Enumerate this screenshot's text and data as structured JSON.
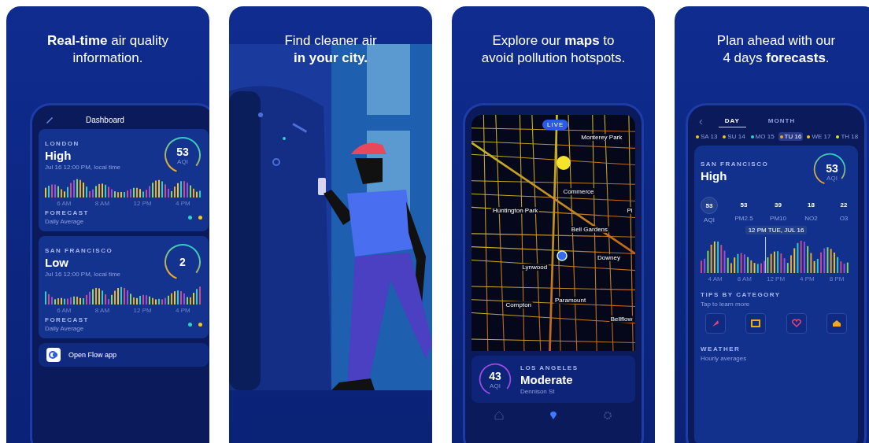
{
  "panels": [
    {
      "kind": "dashboard",
      "caption": [
        "**Real-time** air quality",
        "information."
      ],
      "screen_title": "Dashboard",
      "cities": [
        {
          "city": "LONDON",
          "level": "High",
          "time": "Jul 16 12:00 PM, local time",
          "aqi": "53",
          "aqi_label": "AQI",
          "ticks": [
            "6 AM",
            "8 AM",
            "12 PM",
            "4 PM"
          ],
          "forecast": "FORECAST",
          "forecast_sub": "Daily Average",
          "dots": [
            {
              "color": "#2ad1c9"
            },
            {
              "color": "#f5c518"
            }
          ]
        },
        {
          "city": "SAN FRANCISCO",
          "level": "Low",
          "time": "Jul 16 12:00 PM, local time",
          "aqi": "2",
          "ticks": [
            "6 AM",
            "8 AM",
            "12 PM",
            "4 PM"
          ],
          "forecast": "FORECAST",
          "forecast_sub": "Daily Average",
          "dots": [
            {
              "color": "#2ad1c9"
            },
            {
              "color": "#f5c518"
            }
          ]
        }
      ],
      "open_button": "Open Flow app"
    },
    {
      "kind": "illustration",
      "caption": [
        "Find cleaner air",
        "**in your city.**"
      ]
    },
    {
      "kind": "map",
      "caption": [
        "Explore our **maps** to",
        "avoid pollution hotspots."
      ],
      "live": "LIVE",
      "places": [
        "Monterey Park",
        "Commerce",
        "Huntington Park",
        "Pi",
        "Bell Gardens",
        "Downey",
        "Lynwood",
        "Paramount",
        "Compton",
        "Bellflow"
      ],
      "sheet": {
        "aqi": "43",
        "aqi_label": "AQI",
        "city": "LOS ANGELES",
        "level": "Moderate",
        "street": "Dennison St"
      },
      "nav": [
        {
          "kind": "home",
          "selected": false
        },
        {
          "kind": "pin",
          "selected": true
        },
        {
          "kind": "gear",
          "selected": false
        }
      ]
    },
    {
      "kind": "forecast",
      "caption": [
        "Plan ahead with our",
        "4 days **forecasts**."
      ],
      "back": "‹",
      "tabs": [
        {
          "label": "DAY",
          "selected": true
        },
        {
          "label": "MONTH",
          "selected": false
        }
      ],
      "days": [
        {
          "label": "SA 13",
          "color": "#f5c518",
          "selected": false
        },
        {
          "label": "SU 14",
          "color": "#f5c518",
          "selected": false
        },
        {
          "label": "MO 15",
          "color": "#2ad1c9",
          "selected": false
        },
        {
          "label": "TU 16",
          "color": "#f5a623",
          "selected": true
        },
        {
          "label": "WE 17",
          "color": "#f5c518",
          "selected": false
        },
        {
          "label": "TH 18",
          "color": "#d4e92a",
          "selected": false
        }
      ],
      "city": "SAN FRANCISCO",
      "level": "High",
      "aqi": "53",
      "aqi_label": "AQI",
      "pollutants": [
        {
          "value": "53",
          "label": "AQI",
          "selected": true
        },
        {
          "value": "53",
          "label": "PM2.5",
          "selected": false
        },
        {
          "value": "39",
          "label": "PM10",
          "selected": false
        },
        {
          "value": "18",
          "label": "NO2",
          "selected": false
        },
        {
          "value": "22",
          "label": "O3",
          "selected": false
        }
      ],
      "tooltip": "12 PM TUE, JUL 16",
      "ticks": [
        "4 AM",
        "8 AM",
        "12 PM",
        "4 PM",
        "8 PM"
      ],
      "tips_title": "TIPS BY CATEGORY",
      "tips_sub": "Tap to learn more",
      "tips": [
        {
          "kind": "run"
        },
        {
          "kind": "window"
        },
        {
          "kind": "heart"
        },
        {
          "kind": "home"
        }
      ],
      "weather_title": "WEATHER",
      "weather_sub": "Hourly averages"
    }
  ]
}
